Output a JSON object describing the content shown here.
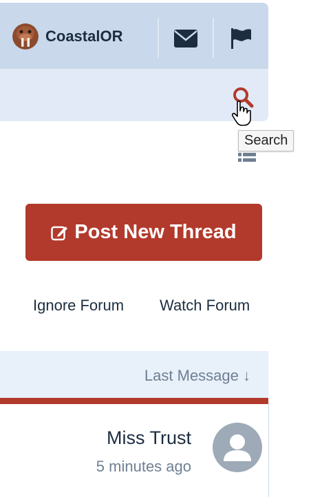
{
  "header": {
    "username": "CoastalOR"
  },
  "tooltip": {
    "text": "Search"
  },
  "actions": {
    "post_thread": "Post New Thread",
    "ignore_forum": "Ignore Forum",
    "watch_forum": "Watch Forum"
  },
  "sort": {
    "label": "Last Message ↓"
  },
  "thread": {
    "last_poster": "Miss Trust",
    "last_time": "5 minutes ago"
  },
  "colors": {
    "accent": "#b23a2c",
    "nav": "#c9d8eb",
    "subnav": "#e1eaf6",
    "text": "#1c2d3f"
  }
}
